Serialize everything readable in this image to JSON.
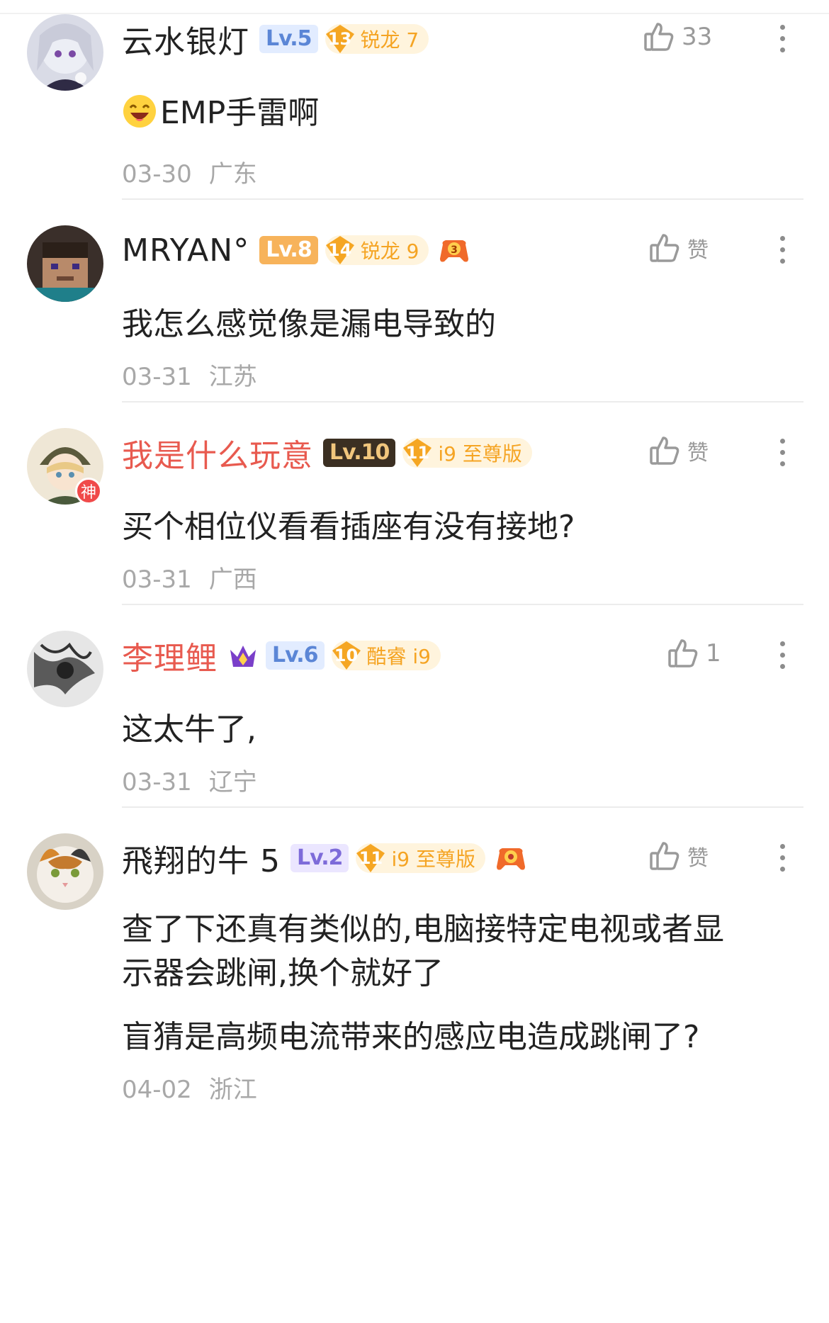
{
  "comments": [
    {
      "username": "云水银灯",
      "level": "Lv.5",
      "fan_level": "13",
      "fan_label": "锐龙 7",
      "likes": "33",
      "text": "EMP手雷啊",
      "text_emoji": "laughing-emoji",
      "date": "03-30",
      "location": "广东"
    },
    {
      "username": "MRYAN°",
      "level": "Lv.8",
      "fan_level": "14",
      "fan_label": "锐龙 9",
      "extra_badge": "3",
      "likes": "赞",
      "text": "我怎么感觉像是漏电导致的",
      "date": "03-31",
      "location": "江苏"
    },
    {
      "username": "我是什么玩意",
      "god_badge": "神",
      "level": "Lv.10",
      "fan_level": "11",
      "fan_label": "i9 至尊版",
      "likes": "赞",
      "text": "买个相位仪看看插座有没有接地?",
      "date": "03-31",
      "location": "广西"
    },
    {
      "username": "李理鲤",
      "level": "Lv.6",
      "fan_level": "10",
      "fan_label": "酷睿 i9",
      "likes": "1",
      "text": "这太牛了,",
      "date": "03-31",
      "location": "辽宁"
    },
    {
      "username": "飛翔的牛 5",
      "level": "Lv.2",
      "fan_level": "11",
      "fan_label": "i9 至尊版",
      "likes": "赞",
      "text_line1": "查了下还真有类似的,电脑接特定电视或者显",
      "text_line2": "示器会跳闸,换个就好了",
      "text_line3": "盲猜是高频电流带来的感应电造成跳闸了?",
      "date": "04-02",
      "location": "浙江"
    }
  ],
  "colors": {
    "accent_red_name": "#e85a4f",
    "fan_badge": "#f5a623",
    "meta_gray": "#a8a8a8"
  }
}
